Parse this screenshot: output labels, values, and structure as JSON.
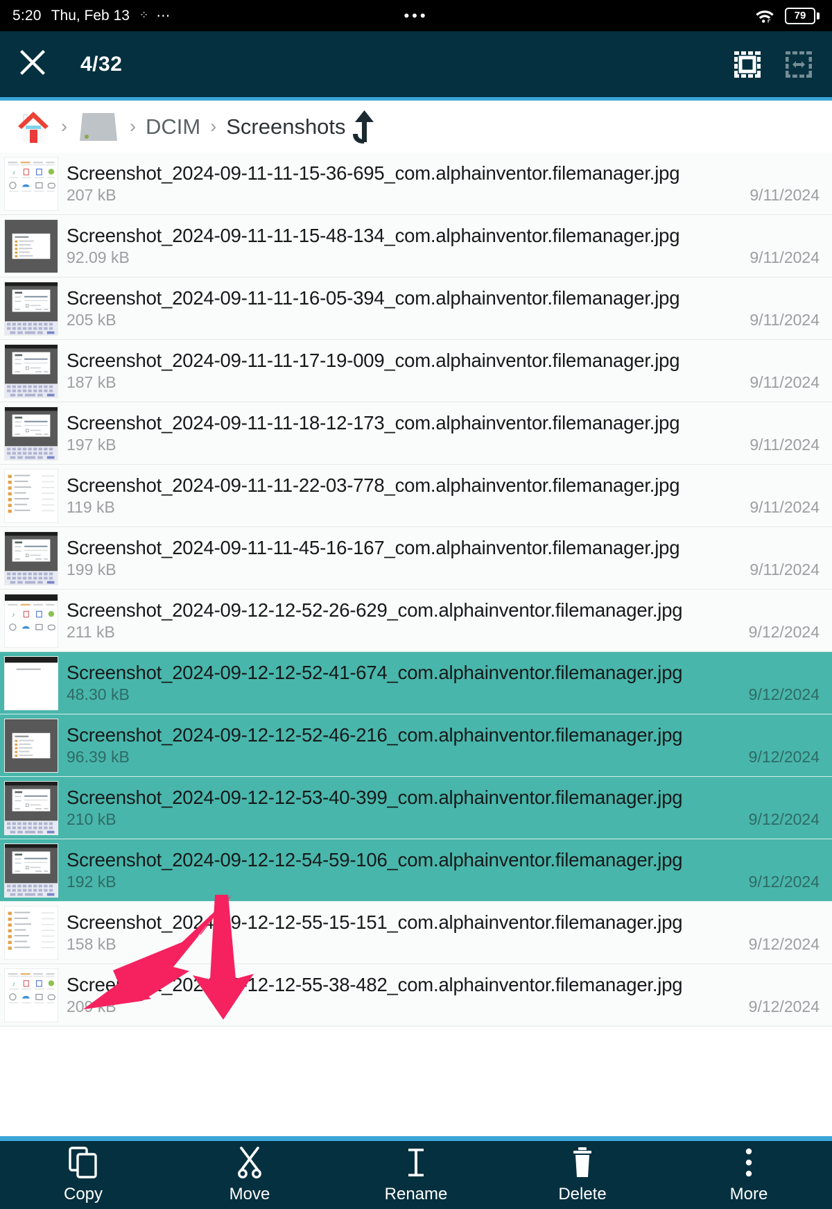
{
  "status_bar": {
    "time": "5:20",
    "date": "Thu, Feb 13",
    "bluetooth_icon": "bluetooth-dots-icon",
    "overflow_icon": "more-dots-icon",
    "center_dots": "•••",
    "wifi_icon": "wifi-icon",
    "battery_level": "79",
    "battery_icon": "battery-icon"
  },
  "app_bar": {
    "close_icon": "close-icon",
    "selection_count": "4/32",
    "select_all_icon": "select-all-icon",
    "invert_selection_icon": "invert-selection-icon",
    "background_color": "#04303f",
    "accent_color": "#3ca5d9"
  },
  "breadcrumb": {
    "home_icon": "home-icon",
    "storage_icon": "storage-drive-icon",
    "separator": "›",
    "items": [
      {
        "label": "DCIM"
      },
      {
        "label": "Screenshots"
      }
    ],
    "up_icon": "go-up-icon"
  },
  "files": [
    {
      "name": "Screenshot_2024-09-11-11-15-36-695_com.alphainventor.filemanager.jpg",
      "size": "207 kB",
      "date": "9/11/2024",
      "selected": false,
      "thumb": "grid-icons"
    },
    {
      "name": "Screenshot_2024-09-11-11-15-48-134_com.alphainventor.filemanager.jpg",
      "size": "92.09 kB",
      "date": "9/11/2024",
      "selected": false,
      "thumb": "dialog-dark"
    },
    {
      "name": "Screenshot_2024-09-11-11-16-05-394_com.alphainventor.filemanager.jpg",
      "size": "205 kB",
      "date": "9/11/2024",
      "selected": false,
      "thumb": "dialog-keyboard"
    },
    {
      "name": "Screenshot_2024-09-11-11-17-19-009_com.alphainventor.filemanager.jpg",
      "size": "187 kB",
      "date": "9/11/2024",
      "selected": false,
      "thumb": "dialog-keyboard"
    },
    {
      "name": "Screenshot_2024-09-11-11-18-12-173_com.alphainventor.filemanager.jpg",
      "size": "197 kB",
      "date": "9/11/2024",
      "selected": false,
      "thumb": "dialog-keyboard"
    },
    {
      "name": "Screenshot_2024-09-11-11-22-03-778_com.alphainventor.filemanager.jpg",
      "size": "119 kB",
      "date": "9/11/2024",
      "selected": false,
      "thumb": "list-light"
    },
    {
      "name": "Screenshot_2024-09-11-11-45-16-167_com.alphainventor.filemanager.jpg",
      "size": "199 kB",
      "date": "9/11/2024",
      "selected": false,
      "thumb": "dialog-keyboard"
    },
    {
      "name": "Screenshot_2024-09-12-12-52-26-629_com.alphainventor.filemanager.jpg",
      "size": "211 kB",
      "date": "9/12/2024",
      "selected": false,
      "thumb": "grid-icons-dark"
    },
    {
      "name": "Screenshot_2024-09-12-12-52-41-674_com.alphainventor.filemanager.jpg",
      "size": "48.30 kB",
      "date": "9/12/2024",
      "selected": true,
      "thumb": "blank-white"
    },
    {
      "name": "Screenshot_2024-09-12-12-52-46-216_com.alphainventor.filemanager.jpg",
      "size": "96.39 kB",
      "date": "9/12/2024",
      "selected": true,
      "thumb": "dialog-dark"
    },
    {
      "name": "Screenshot_2024-09-12-12-53-40-399_com.alphainventor.filemanager.jpg",
      "size": "210 kB",
      "date": "9/12/2024",
      "selected": true,
      "thumb": "dialog-keyboard"
    },
    {
      "name": "Screenshot_2024-09-12-12-54-59-106_com.alphainventor.filemanager.jpg",
      "size": "192 kB",
      "date": "9/12/2024",
      "selected": true,
      "thumb": "dialog-keyboard"
    },
    {
      "name": "Screenshot_2024-09-12-12-55-15-151_com.alphainventor.filemanager.jpg",
      "size": "158 kB",
      "date": "9/12/2024",
      "selected": false,
      "thumb": "list-light"
    },
    {
      "name": "Screenshot_2024-09-12-12-55-38-482_com.alphainventor.filemanager.jpg",
      "size": "209 kB",
      "date": "9/12/2024",
      "selected": false,
      "thumb": "grid-icons"
    }
  ],
  "bottom_bar": {
    "actions": [
      {
        "label": "Copy",
        "icon": "copy-icon"
      },
      {
        "label": "Move",
        "icon": "scissors-icon"
      },
      {
        "label": "Rename",
        "icon": "text-cursor-icon"
      },
      {
        "label": "Delete",
        "icon": "trash-icon"
      },
      {
        "label": "More",
        "icon": "more-vertical-icon"
      }
    ],
    "background_color": "#04303f",
    "accent_color": "#3ca5d9"
  },
  "annotations": {
    "arrow_color": "#f5225f",
    "arrows": [
      {
        "name": "arrow-pointing-copy"
      },
      {
        "name": "arrow-pointing-move"
      }
    ]
  },
  "colors": {
    "selection_teal": "#49b6ab",
    "row_background": "#fafbfb",
    "toolbar_dark": "#04303f",
    "accent_blue": "#3ca5d9"
  }
}
